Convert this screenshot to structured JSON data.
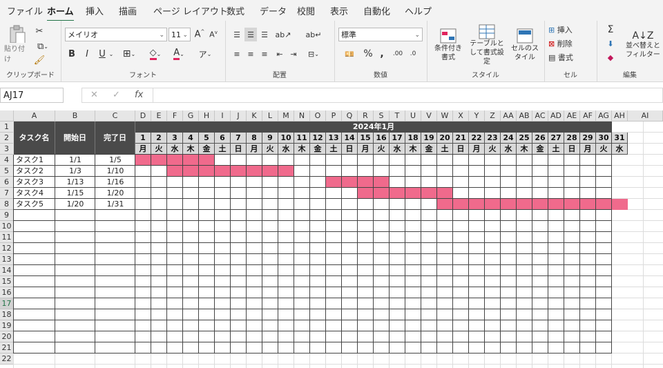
{
  "menu": [
    "ファイル",
    "ホーム",
    "挿入",
    "描画",
    "ページ レイアウト",
    "数式",
    "データ",
    "校閲",
    "表示",
    "自動化",
    "ヘルプ"
  ],
  "active_menu": "ホーム",
  "ribbon": {
    "clipboard": {
      "label": "クリップボード",
      "paste": "貼り付け"
    },
    "font": {
      "label": "フォント",
      "font_name": "メイリオ",
      "font_size": "11",
      "bold": "B",
      "italic": "I",
      "underline": "U"
    },
    "alignment": {
      "label": "配置"
    },
    "number": {
      "label": "数値",
      "format": "標準"
    },
    "styles": {
      "label": "スタイル",
      "conditional": "条件付き書式",
      "table": "テーブルとして書式設定",
      "cell_styles": "セルのスタイル"
    },
    "cells": {
      "label": "セル",
      "insert": "挿入",
      "delete": "削除",
      "format": "書式"
    },
    "editing": {
      "label": "編集",
      "sort_filter": "並べ替えとフィルター"
    }
  },
  "formula_bar": {
    "name_box": "AJ17",
    "fx": "fx",
    "value": ""
  },
  "columns": [
    "A",
    "B",
    "C",
    "D",
    "E",
    "F",
    "G",
    "H",
    "I",
    "J",
    "K",
    "L",
    "M",
    "N",
    "O",
    "P",
    "Q",
    "R",
    "S",
    "T",
    "U",
    "V",
    "W",
    "X",
    "Y",
    "Z",
    "AA",
    "AB",
    "AC",
    "AD",
    "AE",
    "AF",
    "AG",
    "AH",
    "AI"
  ],
  "rows": [
    "1",
    "2",
    "3",
    "4",
    "5",
    "6",
    "7",
    "8",
    "9",
    "10",
    "11",
    "12",
    "13",
    "14",
    "15",
    "16",
    "17",
    "18",
    "19",
    "20",
    "21",
    "22"
  ],
  "sheet": {
    "headers": {
      "task": "タスク名",
      "start": "開始日",
      "end": "完了日"
    },
    "month_label": "2024年1月",
    "days": [
      "1",
      "2",
      "3",
      "4",
      "5",
      "6",
      "7",
      "8",
      "9",
      "10",
      "11",
      "12",
      "13",
      "14",
      "15",
      "16",
      "17",
      "18",
      "19",
      "20",
      "21",
      "22",
      "23",
      "24",
      "25",
      "26",
      "27",
      "28",
      "29",
      "30",
      "31"
    ],
    "weekdays": [
      "月",
      "火",
      "水",
      "木",
      "金",
      "土",
      "日",
      "月",
      "火",
      "水",
      "木",
      "金",
      "土",
      "日",
      "月",
      "火",
      "水",
      "木",
      "金",
      "土",
      "日",
      "月",
      "火",
      "水",
      "木",
      "金",
      "土",
      "日",
      "月",
      "火",
      "水"
    ],
    "tasks": [
      {
        "name": "タスク1",
        "start": "1/1",
        "end": "1/5",
        "from": 1,
        "to": 5
      },
      {
        "name": "タスク2",
        "start": "1/3",
        "end": "1/10",
        "from": 3,
        "to": 10
      },
      {
        "name": "タスク3",
        "start": "1/13",
        "end": "1/16",
        "from": 13,
        "to": 16
      },
      {
        "name": "タスク4",
        "start": "1/15",
        "end": "1/20",
        "from": 15,
        "to": 20
      },
      {
        "name": "タスク5",
        "start": "1/20",
        "end": "1/31",
        "from": 20,
        "to": 31
      }
    ],
    "bar_color": "#f06a8c",
    "header_dark": "#4a4a4a",
    "header_light": "#d9d9d9"
  },
  "colors": {
    "accent": "#217346"
  }
}
